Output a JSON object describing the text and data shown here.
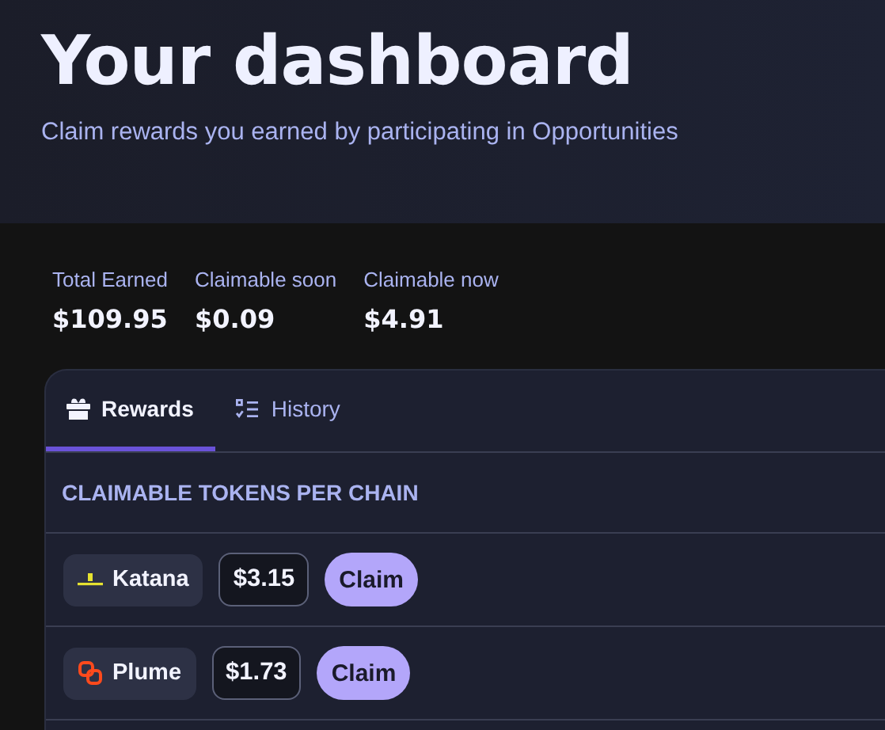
{
  "header": {
    "title": "Your dashboard",
    "subtitle": "Claim rewards you earned by participating in Opportunities"
  },
  "stats": [
    {
      "label": "Total Earned",
      "value": "$109.95"
    },
    {
      "label": "Claimable soon",
      "value": "$0.09"
    },
    {
      "label": "Claimable now",
      "value": "$4.91"
    }
  ],
  "tabs": [
    {
      "label": "Rewards",
      "kind": "rewards",
      "selected": true
    },
    {
      "label": "History",
      "kind": "history",
      "selected": false
    }
  ],
  "section_heading": "CLAIMABLE TOKENS PER CHAIN",
  "chains": [
    {
      "name": "Katana",
      "kind": "katana",
      "amount": "$3.15",
      "action": "Claim"
    },
    {
      "name": "Plume",
      "kind": "plume",
      "amount": "$1.73",
      "action": "Claim"
    }
  ]
}
